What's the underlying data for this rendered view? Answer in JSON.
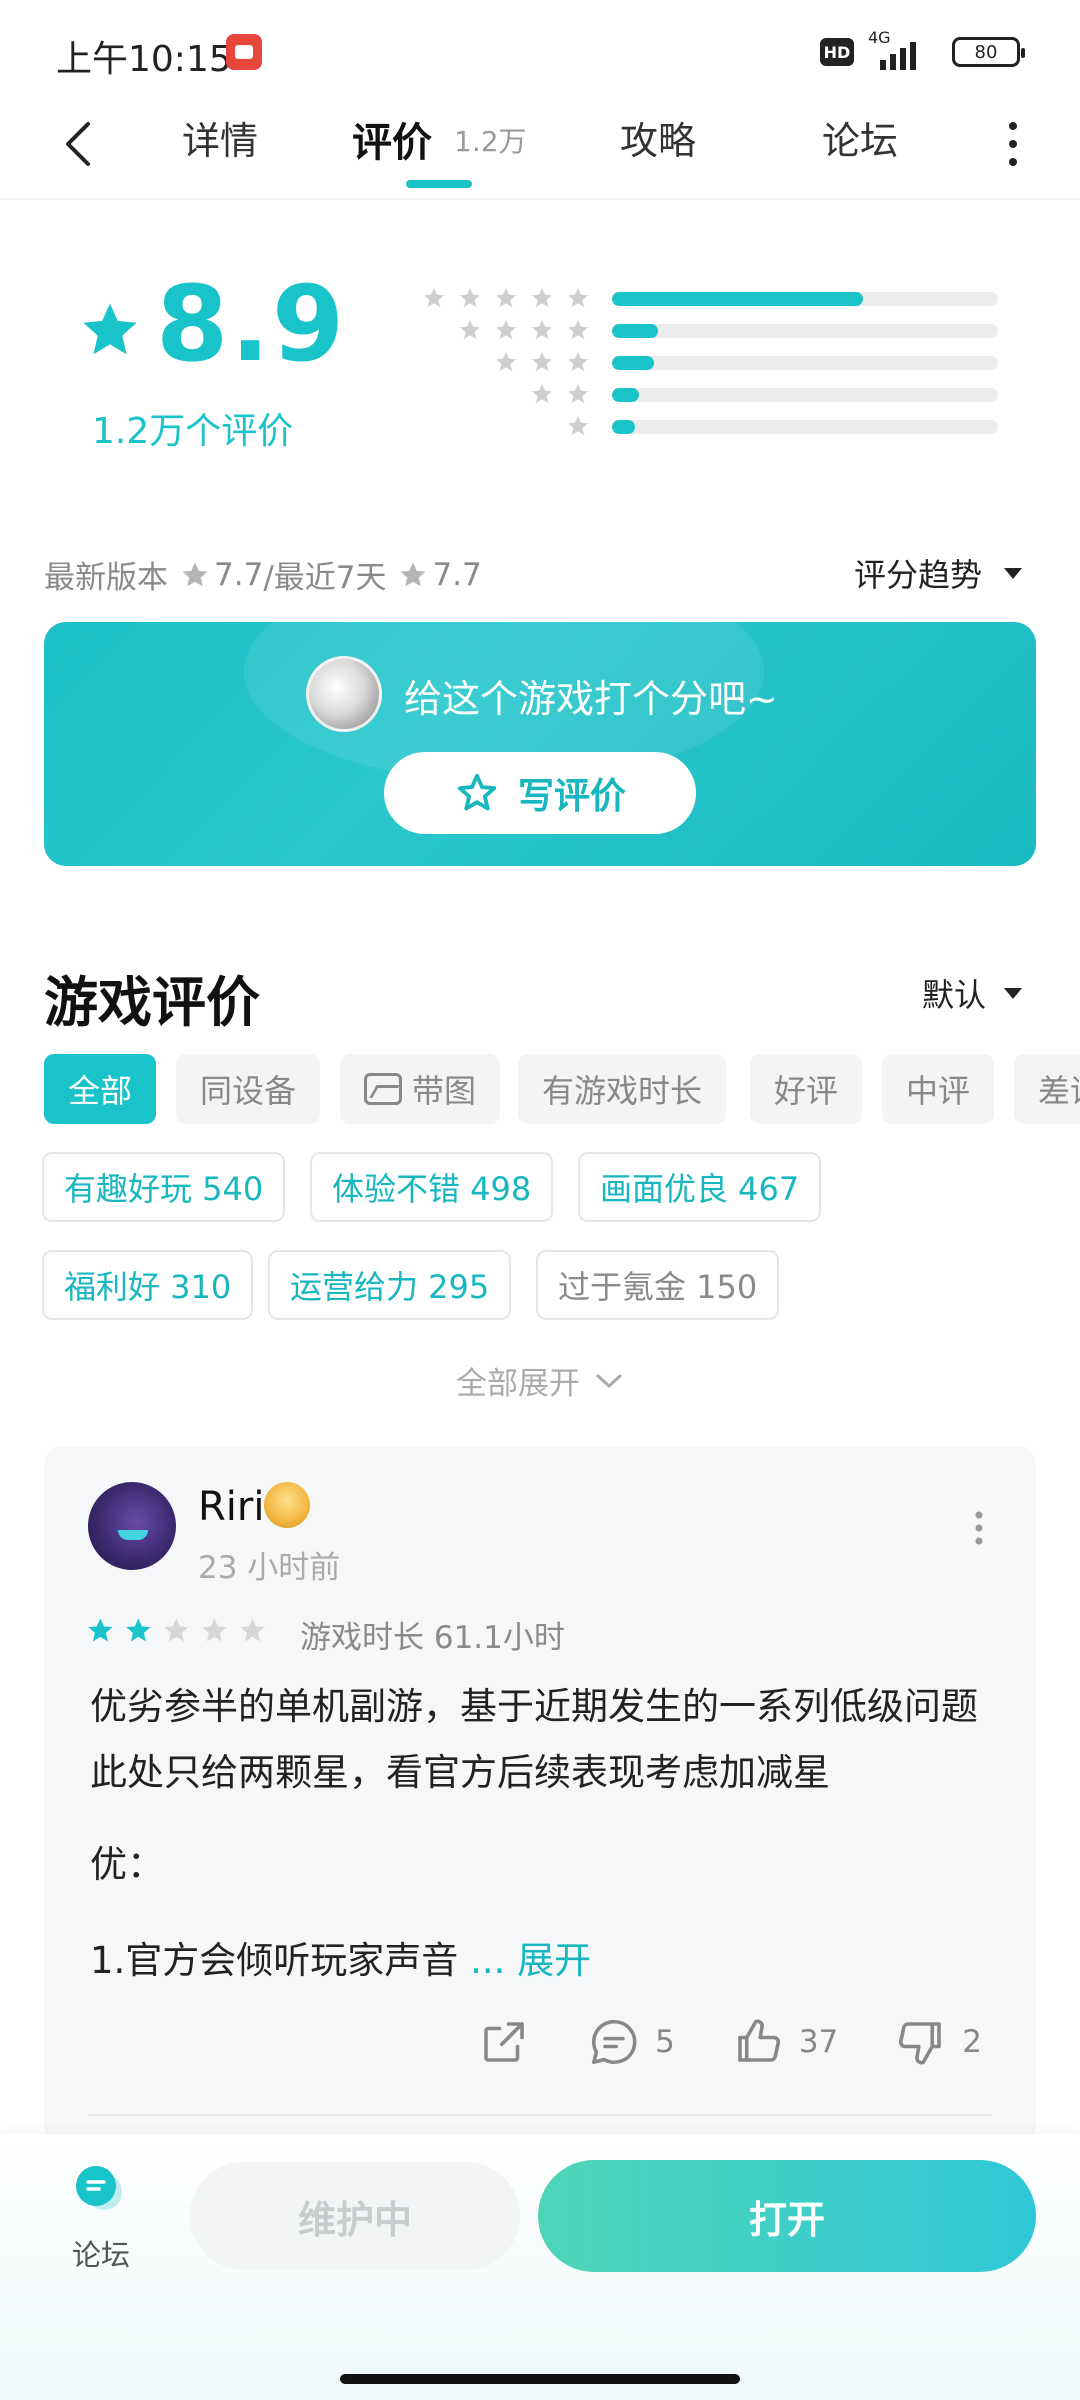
{
  "status": {
    "time": "上午10:15",
    "hd": "HD",
    "net": "4G",
    "battery": "80"
  },
  "nav": {
    "tabs": [
      "详情",
      "评价",
      "攻略",
      "论坛"
    ],
    "active_tab": "评价",
    "review_count": "1.2万"
  },
  "summary": {
    "score": "8.9",
    "rating_count": "1.2万个评价",
    "distribution": [
      {
        "stars": 5,
        "fraction": 0.65
      },
      {
        "stars": 4,
        "fraction": 0.12
      },
      {
        "stars": 3,
        "fraction": 0.11
      },
      {
        "stars": 2,
        "fraction": 0.07
      },
      {
        "stars": 1,
        "fraction": 0.06
      }
    ],
    "latest_version_label": "最新版本",
    "latest_version_score": "7.7",
    "recent_label": "/最近7天",
    "recent_score": "7.7",
    "trend_label": "评分趋势"
  },
  "banner": {
    "prompt": "给这个游戏打个分吧~",
    "button": "写评价"
  },
  "reviews": {
    "title": "游戏评价",
    "sort": "默认",
    "filters": [
      "全部",
      "同设备",
      "带图",
      "有游戏时长",
      "好评",
      "中评",
      "差评"
    ],
    "active_filter": "全部",
    "tags": [
      {
        "label": "有趣好玩 540",
        "type": "pos"
      },
      {
        "label": "体验不错 498",
        "type": "pos"
      },
      {
        "label": "画面优良 467",
        "type": "pos"
      },
      {
        "label": "福利好 310",
        "type": "pos"
      },
      {
        "label": "运营给力 295",
        "type": "pos"
      },
      {
        "label": "过于氪金 150",
        "type": "neg"
      }
    ],
    "expand_all": "全部展开",
    "items": [
      {
        "user": "Riri",
        "time": "23 小时前",
        "stars": 2,
        "playtime": "游戏时长 61.1小时",
        "text": "优劣参半的单机副游，基于近期发生的一系列低级问题此处只给两颗星，看官方后续表现考虑加减星",
        "label": "优：",
        "line": "1.官方会倾听玩家声音",
        "ellipsis": " ... ",
        "expand": "展开",
        "comments": "5",
        "likes": "37",
        "dislikes": "2"
      }
    ]
  },
  "bottom": {
    "forum": "论坛",
    "maintenance": "维护中",
    "open": "打开"
  },
  "colors": {
    "accent": "#18c4c9",
    "accent_dark": "#18b6be",
    "star_gray": "#cfcfcf"
  }
}
